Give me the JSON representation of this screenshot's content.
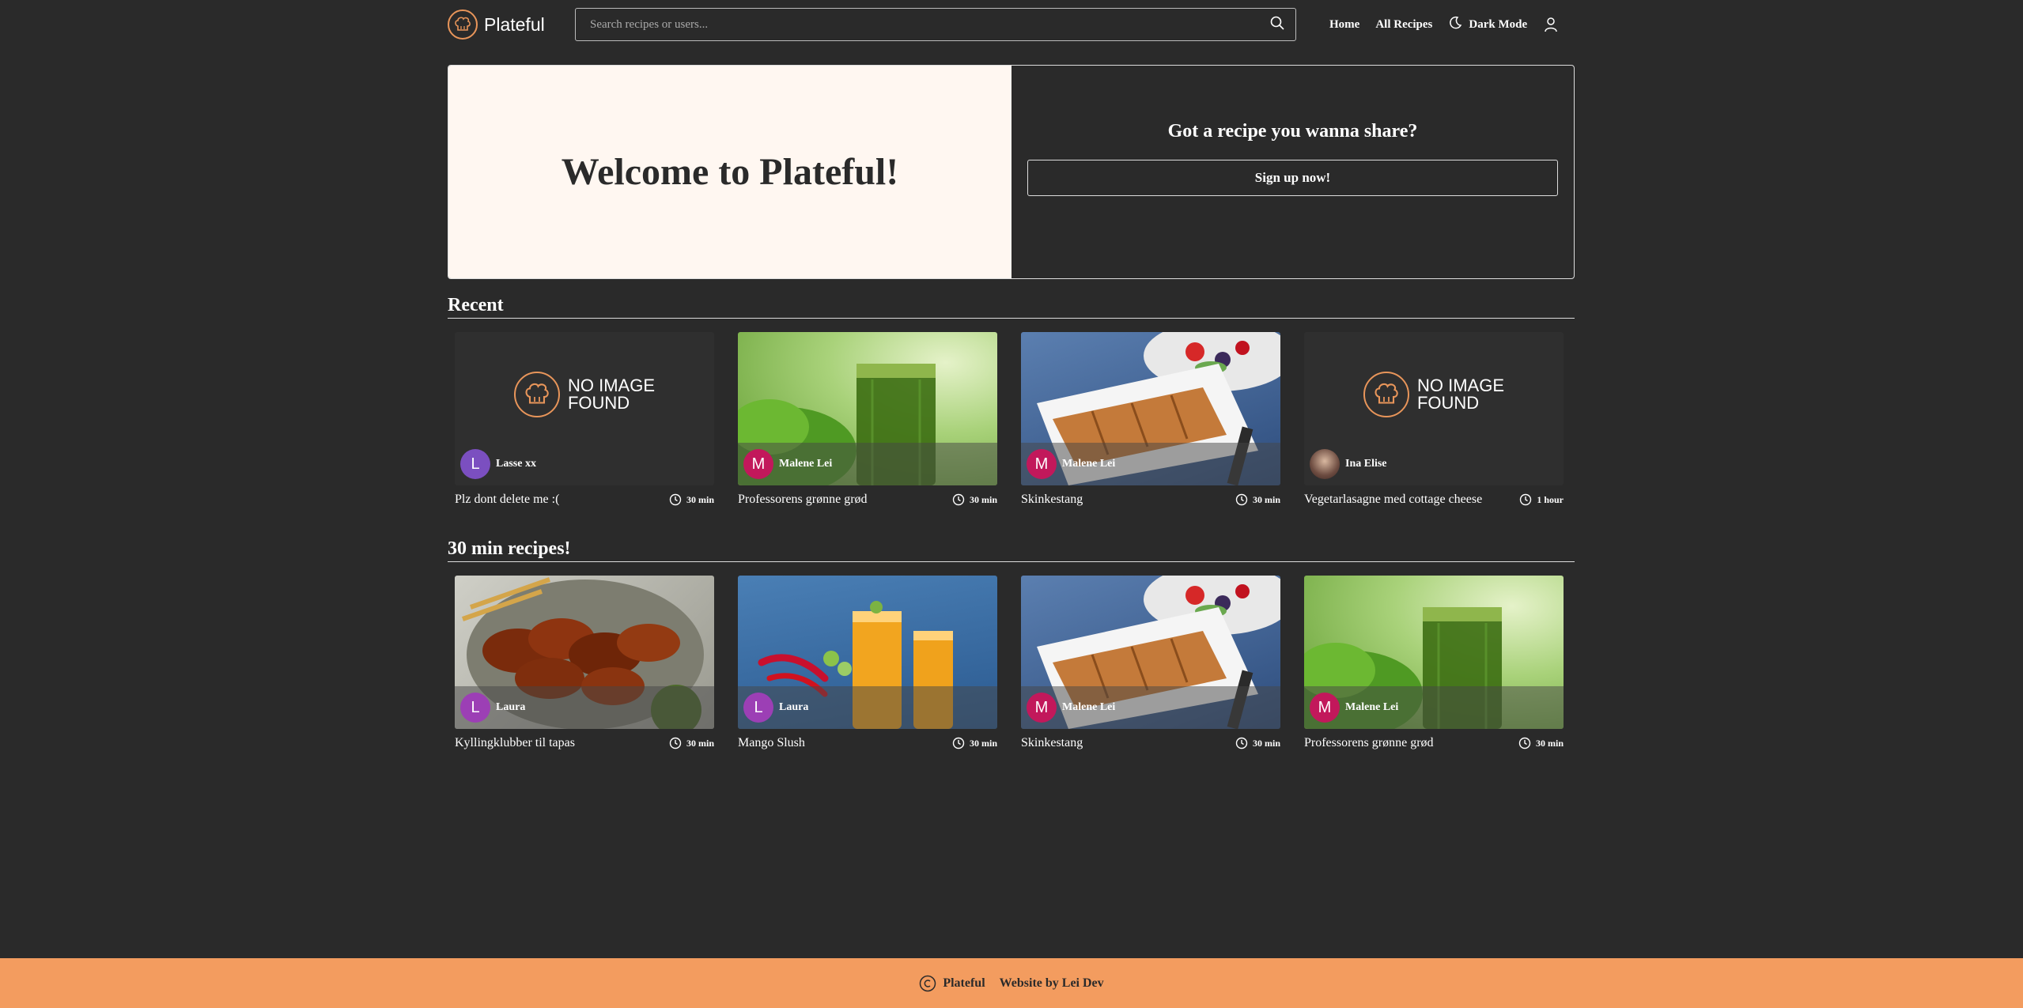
{
  "header": {
    "brand": "Plateful",
    "search_placeholder": "Search recipes or users...",
    "nav": {
      "home": "Home",
      "all_recipes": "All Recipes",
      "dark_mode": "Dark Mode"
    }
  },
  "hero": {
    "title": "Welcome to Plateful!",
    "question": "Got a recipe you wanna share?",
    "signup": "Sign up now!"
  },
  "no_image": {
    "line1": "NO IMAGE",
    "line2": "FOUND"
  },
  "sections": [
    {
      "title": "Recent",
      "cards": [
        {
          "image": "none",
          "author": "Lasse xx",
          "initial": "L",
          "avatar_color": "#7b4fc0",
          "title": "Plz dont delete me :(",
          "time": "30 min"
        },
        {
          "image": "green-juice",
          "author": "Malene Lei",
          "initial": "M",
          "avatar_color": "#c2185b",
          "title": "Professorens grønne grød",
          "time": "30 min"
        },
        {
          "image": "pastry-salad",
          "author": "Malene Lei",
          "initial": "M",
          "avatar_color": "#c2185b",
          "title": "Skinkestang",
          "time": "30 min"
        },
        {
          "image": "none",
          "author": "Ina Elise",
          "initial": "",
          "avatar_color": "#6d4c41",
          "title": "Vegetarlasagne med cottage cheese",
          "time": "1 hour"
        }
      ]
    },
    {
      "title": "30 min recipes!",
      "cards": [
        {
          "image": "chicken-wings",
          "author": "Laura",
          "initial": "L",
          "avatar_color": "#9c3fb5",
          "title": "Kyllingklubber til tapas",
          "time": "30 min"
        },
        {
          "image": "mango-slush",
          "author": "Laura",
          "initial": "L",
          "avatar_color": "#9c3fb5",
          "title": "Mango Slush",
          "time": "30 min"
        },
        {
          "image": "pastry-salad",
          "author": "Malene Lei",
          "initial": "M",
          "avatar_color": "#c2185b",
          "title": "Skinkestang",
          "time": "30 min"
        },
        {
          "image": "green-juice",
          "author": "Malene Lei",
          "initial": "M",
          "avatar_color": "#c2185b",
          "title": "Professorens grønne grød",
          "time": "30 min"
        }
      ]
    }
  ],
  "footer": {
    "brand": "Plateful",
    "credit": "Website by Lei Dev"
  },
  "colors": {
    "background": "#2a2a2a",
    "accent": "#f39c5f",
    "hero_bg": "#fff7f1"
  }
}
